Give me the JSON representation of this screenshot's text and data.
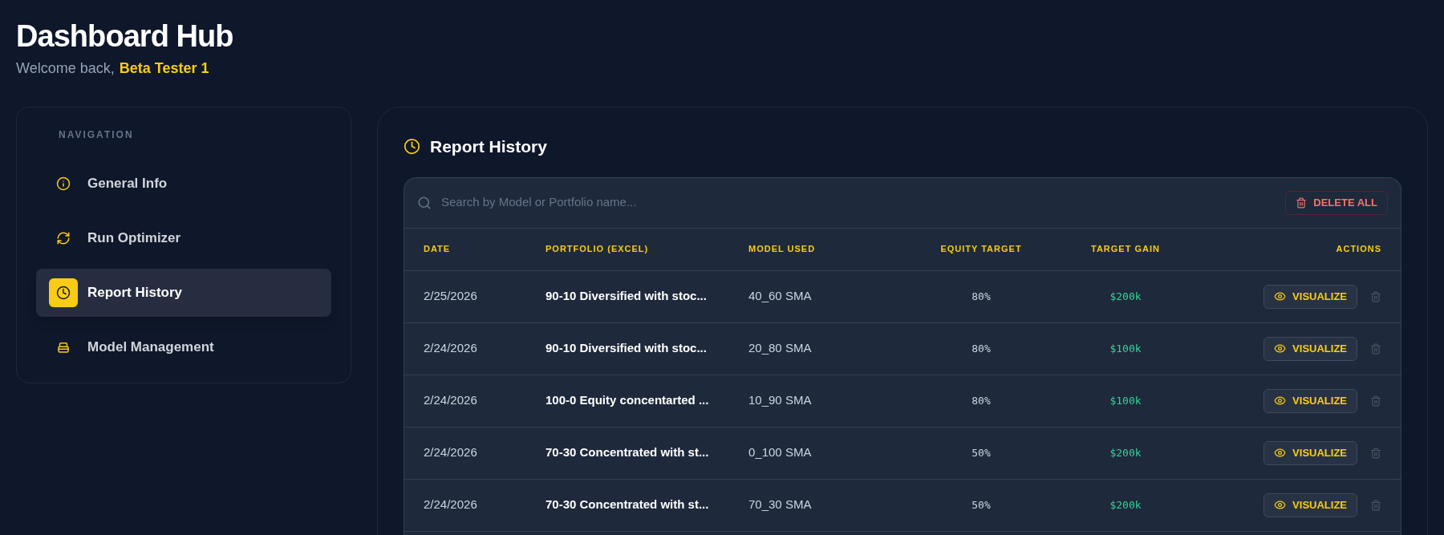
{
  "header": {
    "title": "Dashboard Hub",
    "welcome": "Welcome back,",
    "user": "Beta Tester 1"
  },
  "navigation": {
    "heading": "NAVIGATION",
    "items": [
      {
        "label": "General Info",
        "kind": "info",
        "selected": false
      },
      {
        "label": "Run Optimizer",
        "kind": "refresh",
        "selected": false
      },
      {
        "label": "Report History",
        "kind": "clock",
        "selected": true
      },
      {
        "label": "Model Management",
        "kind": "stack",
        "selected": false
      }
    ]
  },
  "panel": {
    "title": "Report History",
    "search": {
      "placeholder": "Search by Model or Portfolio name..."
    },
    "delete_all": "DELETE ALL",
    "table": {
      "columns": [
        "DATE",
        "PORTFOLIO (EXCEL)",
        "MODEL USED",
        "EQUITY TARGET",
        "TARGET GAIN",
        "ACTIONS"
      ],
      "rows": [
        {
          "date": "2/25/2026",
          "portfolio": "90-10 Diversified with stoc...",
          "model": "40_60 SMA",
          "equity": "80%",
          "gain": "$200k",
          "action": "VISUALIZE"
        },
        {
          "date": "2/24/2026",
          "portfolio": "90-10 Diversified with stoc...",
          "model": "20_80 SMA",
          "equity": "80%",
          "gain": "$100k",
          "action": "VISUALIZE"
        },
        {
          "date": "2/24/2026",
          "portfolio": "100-0 Equity concentarted ...",
          "model": "10_90 SMA",
          "equity": "80%",
          "gain": "$100k",
          "action": "VISUALIZE"
        },
        {
          "date": "2/24/2026",
          "portfolio": "70-30 Concentrated with st...",
          "model": "0_100 SMA",
          "equity": "50%",
          "gain": "$200k",
          "action": "VISUALIZE"
        },
        {
          "date": "2/24/2026",
          "portfolio": "70-30 Concentrated with st...",
          "model": "70_30 SMA",
          "equity": "50%",
          "gain": "$200k",
          "action": "VISUALIZE"
        }
      ]
    }
  }
}
